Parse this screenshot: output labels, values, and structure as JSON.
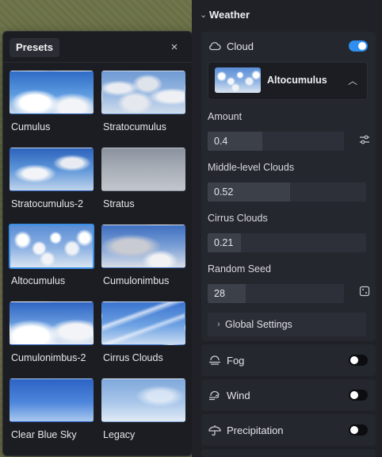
{
  "presets_panel": {
    "title": "Presets",
    "close_glyph": "×",
    "items": [
      {
        "label": "Cumulus",
        "sky": "cumulus",
        "selected": false
      },
      {
        "label": "Stratocumulus",
        "sky": "strato",
        "selected": false
      },
      {
        "label": "Stratocumulus-2",
        "sky": "strato2",
        "selected": false
      },
      {
        "label": "Stratus",
        "sky": "stratus",
        "selected": false
      },
      {
        "label": "Altocumulus",
        "sky": "alto",
        "selected": true
      },
      {
        "label": "Cumulonimbus",
        "sky": "cumulonimbus",
        "selected": false
      },
      {
        "label": "Cumulonimbus-2",
        "sky": "cumulonimbus2",
        "selected": false
      },
      {
        "label": "Cirrus Clouds",
        "sky": "cirrus",
        "selected": false
      },
      {
        "label": "Clear Blue Sky",
        "sky": "clear",
        "selected": false
      },
      {
        "label": "Legacy",
        "sky": "legacy",
        "selected": false
      }
    ]
  },
  "weather": {
    "title": "Weather",
    "cloud": {
      "title": "Cloud",
      "enabled": true,
      "selected_preset": "Altocumulus",
      "amount": {
        "label": "Amount",
        "value": "0.4",
        "fraction": 0.4
      },
      "middle": {
        "label": "Middle-level Clouds",
        "value": "0.52",
        "fraction": 0.52
      },
      "cirrus": {
        "label": "Cirrus Clouds",
        "value": "0.21",
        "fraction": 0.21
      },
      "seed": {
        "label": "Random Seed",
        "value": "28",
        "fraction": 0.28
      },
      "global_settings": "Global Settings"
    },
    "fog": {
      "title": "Fog",
      "enabled": false
    },
    "wind": {
      "title": "Wind",
      "enabled": false
    },
    "precipitation": {
      "title": "Precipitation",
      "enabled": false
    }
  },
  "colors": {
    "accent": "#2f8ef0",
    "panel": "#1f2127",
    "section": "#24272e"
  }
}
